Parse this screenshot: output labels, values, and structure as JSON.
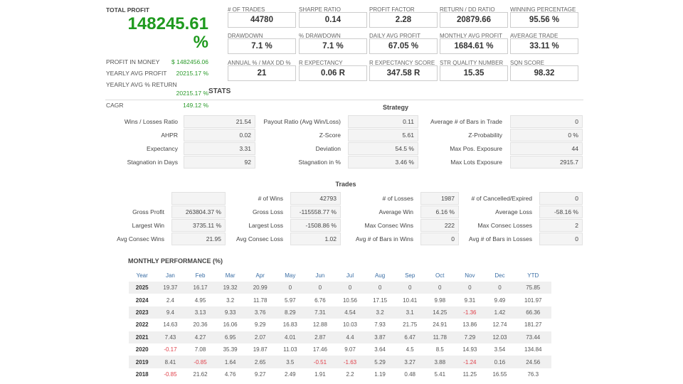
{
  "summary": {
    "total_profit_label": "TOTAL PROFIT",
    "total_profit_value": "148245.61",
    "total_profit_unit": "%",
    "rows": [
      {
        "label": "PROFIT IN MONEY",
        "value": "$ 1482456.06"
      },
      {
        "label": "YEARLY AVG PROFIT",
        "value": "20215.17 %"
      },
      {
        "label": "YEARLY AVG % RETURN",
        "value": "20215.17 %"
      },
      {
        "label": "CAGR",
        "value": "149.12 %"
      }
    ]
  },
  "metrics": [
    {
      "label": "# OF TRADES",
      "value": "44780"
    },
    {
      "label": "SHARPE RATIO",
      "value": "0.14"
    },
    {
      "label": "PROFIT FACTOR",
      "value": "2.28"
    },
    {
      "label": "RETURN / DD RATIO",
      "value": "20879.66"
    },
    {
      "label": "WINNING PERCENTAGE",
      "value": "95.56 %"
    },
    {
      "label": "DRAWDOWN",
      "value": "7.1 %"
    },
    {
      "label": "% DRAWDOWN",
      "value": "7.1 %"
    },
    {
      "label": "DAILY AVG PROFIT",
      "value": "67.05 %"
    },
    {
      "label": "MONTHLY AVG PROFIT",
      "value": "1684.61 %"
    },
    {
      "label": "AVERAGE TRADE",
      "value": "33.11 %"
    },
    {
      "label": "ANNUAL % / MAX DD %",
      "value": "21"
    },
    {
      "label": "R EXPECTANCY",
      "value": "0.06 R"
    },
    {
      "label": "R EXPECTANCY SCORE",
      "value": "347.58 R"
    },
    {
      "label": "STR QUALITY NUMBER",
      "value": "15.35"
    },
    {
      "label": "SQN SCORE",
      "value": "98.32"
    }
  ],
  "stats_title": "STATS",
  "strategy": {
    "title": "Strategy",
    "rows": [
      [
        {
          "label": "Wins / Losses Ratio",
          "value": "21.54"
        },
        {
          "label": "Payout Ratio (Avg Win/Loss)",
          "value": "0.11"
        },
        {
          "label": "Average # of Bars in Trade",
          "value": "0"
        }
      ],
      [
        {
          "label": "AHPR",
          "value": "0.02"
        },
        {
          "label": "Z-Score",
          "value": "5.61"
        },
        {
          "label": "Z-Probability",
          "value": "0 %"
        }
      ],
      [
        {
          "label": "Expectancy",
          "value": "3.31"
        },
        {
          "label": "Deviation",
          "value": "54.5 %"
        },
        {
          "label": "Max Pos. Exposure",
          "value": "44"
        }
      ],
      [
        {
          "label": "Stagnation in Days",
          "value": "92"
        },
        {
          "label": "Stagnation in %",
          "value": "3.46 %"
        },
        {
          "label": "Max Lots Exposure",
          "value": "2915.7"
        }
      ]
    ]
  },
  "trades": {
    "title": "Trades",
    "rows": [
      [
        {
          "label": "",
          "value": ""
        },
        {
          "label": "# of Wins",
          "value": "42793"
        },
        {
          "label": "# of Losses",
          "value": "1987"
        },
        {
          "label": "# of Cancelled/Expired",
          "value": "0"
        }
      ],
      [
        {
          "label": "Gross Profit",
          "value": "263804.37 %"
        },
        {
          "label": "Gross Loss",
          "value": "-115558.77 %"
        },
        {
          "label": "Average Win",
          "value": "6.16 %"
        },
        {
          "label": "Average Loss",
          "value": "-58.16 %"
        }
      ],
      [
        {
          "label": "Largest Win",
          "value": "3735.11 %"
        },
        {
          "label": "Largest Loss",
          "value": "-1508.86 %"
        },
        {
          "label": "Max Consec Wins",
          "value": "222"
        },
        {
          "label": "Max Consec Losses",
          "value": "2"
        }
      ],
      [
        {
          "label": "Avg Consec Wins",
          "value": "21.95"
        },
        {
          "label": "Avg Consec Loss",
          "value": "1.02"
        },
        {
          "label": "Avg # of Bars in Wins",
          "value": "0"
        },
        {
          "label": "Avg # of Bars in Losses",
          "value": "0"
        }
      ]
    ]
  },
  "monthly": {
    "title": "MONTHLY PERFORMANCE (%)",
    "headers": [
      "Year",
      "Jan",
      "Feb",
      "Mar",
      "Apr",
      "May",
      "Jun",
      "Jul",
      "Aug",
      "Sep",
      "Oct",
      "Nov",
      "Dec",
      "YTD"
    ],
    "rows": [
      [
        "2025",
        "19.37",
        "16.17",
        "19.32",
        "20.99",
        "0",
        "0",
        "0",
        "0",
        "0",
        "0",
        "0",
        "0",
        "75.85"
      ],
      [
        "2024",
        "2.4",
        "4.95",
        "3.2",
        "11.78",
        "5.97",
        "6.76",
        "10.56",
        "17.15",
        "10.41",
        "9.98",
        "9.31",
        "9.49",
        "101.97"
      ],
      [
        "2023",
        "9.4",
        "3.13",
        "9.33",
        "3.76",
        "8.29",
        "7.31",
        "4.54",
        "3.2",
        "3.1",
        "14.25",
        "-1.36",
        "1.42",
        "66.36"
      ],
      [
        "2022",
        "14.63",
        "20.36",
        "16.06",
        "9.29",
        "16.83",
        "12.88",
        "10.03",
        "7.93",
        "21.75",
        "24.91",
        "13.86",
        "12.74",
        "181.27"
      ],
      [
        "2021",
        "7.43",
        "4.27",
        "6.95",
        "2.07",
        "4.01",
        "2.87",
        "4.4",
        "3.87",
        "6.47",
        "11.78",
        "7.29",
        "12.03",
        "73.44"
      ],
      [
        "2020",
        "-0.17",
        "7.08",
        "35.39",
        "19.87",
        "11.03",
        "17.46",
        "9.07",
        "3.64",
        "4.5",
        "8.5",
        "14.93",
        "3.54",
        "134.84"
      ],
      [
        "2019",
        "8.41",
        "-0.85",
        "1.64",
        "2.65",
        "3.5",
        "-0.51",
        "-1.63",
        "5.29",
        "3.27",
        "3.88",
        "-1.24",
        "0.16",
        "24.56"
      ],
      [
        "2018",
        "-0.85",
        "21.62",
        "4.76",
        "9.27",
        "2.49",
        "1.91",
        "2.2",
        "1.19",
        "0.48",
        "5.41",
        "11.25",
        "16.55",
        "76.3"
      ]
    ]
  },
  "colors": {
    "positive": "#2a9a2a",
    "total_profit": "#1f9a1f",
    "negative": "#e0404a",
    "header": "#3a6ea5"
  }
}
